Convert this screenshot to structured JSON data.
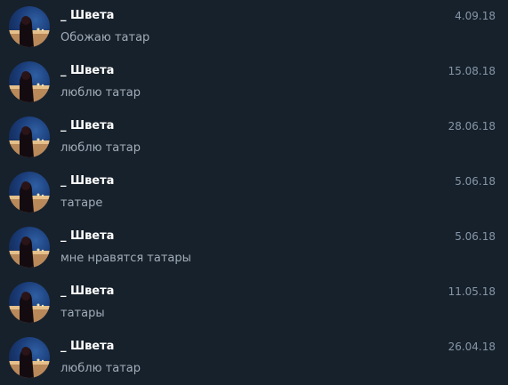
{
  "messages": [
    {
      "name": "_ Швета",
      "date": "4.09.18",
      "text": "Обожаю татар"
    },
    {
      "name": "_ Швета",
      "date": "15.08.18",
      "text": "люблю татар"
    },
    {
      "name": "_ Швета",
      "date": "28.06.18",
      "text": "люблю татар"
    },
    {
      "name": "_ Швета",
      "date": "5.06.18",
      "text": "татаре"
    },
    {
      "name": "_ Швета",
      "date": "5.06.18",
      "text": "мне нравятся татары"
    },
    {
      "name": "_ Швета",
      "date": "11.05.18",
      "text": "татары"
    },
    {
      "name": "_ Швета",
      "date": "26.04.18",
      "text": "люблю татар"
    }
  ],
  "colors": {
    "background": "#17212b",
    "name": "#ffffff",
    "date": "#8596a8",
    "text": "#a1adba"
  }
}
